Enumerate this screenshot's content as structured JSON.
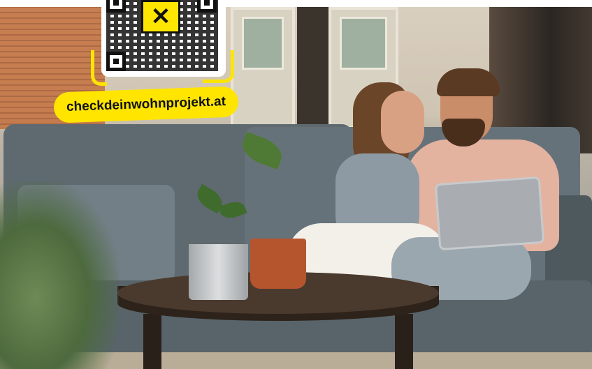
{
  "brand": {
    "url_text": "checkdeinwohnprojekt.at",
    "accent_color": "#ffe500",
    "logo_icon": "raiffeisen-giebelkreuz-icon",
    "qr_icon": "qr-code-icon"
  },
  "scene": {
    "image_subject": "photo"
  }
}
